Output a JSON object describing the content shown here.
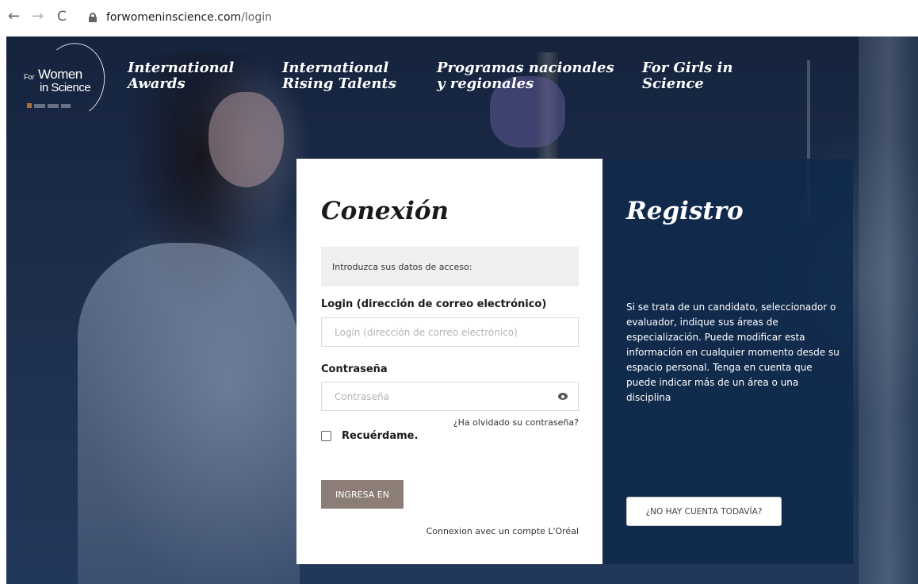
{
  "browser": {
    "url_domain": "forwomeninscience.com",
    "url_path": "/login",
    "back_icon": "←",
    "forward_icon": "→",
    "reload_icon": "C"
  },
  "logo": {
    "for": "For",
    "women": "Women",
    "in_science": "in Science"
  },
  "nav": [
    {
      "line1": "International",
      "line2": "Awards"
    },
    {
      "line1": "International",
      "line2": "Rising Talents"
    },
    {
      "line1": "Programas nacionales",
      "line2": "y regionales"
    },
    {
      "line1": "For Girls in",
      "line2": "Science"
    }
  ],
  "login": {
    "title": "Conexión",
    "info": "Introduzca sus datos de acceso:",
    "email_label": "Login (dirección de correo electrónico)",
    "email_placeholder": "Login (dirección de correo electrónico)",
    "password_label": "Contraseña",
    "password_placeholder": "Contraseña",
    "forgot": "¿Ha olvidado su contraseña?",
    "remember": "Recuérdame.",
    "submit": "INGRESA EN",
    "loreal": "Connexion avec un compte L'Oréal"
  },
  "register": {
    "title": "Registro",
    "text": "Si se trata de un candidato, seleccionador o evaluador, indique sus áreas de especialización. Puede modificar esta información en cualquier momento desde su espacio personal. Tenga en cuenta que puede indicar más de un área o una disciplina",
    "button": "¿NO HAY CUENTA TODAVÍA?"
  },
  "colors": {
    "page_background": "#1d2e4c",
    "register_panel": "#102a4c",
    "submit_button": "#8c7d77",
    "info_box": "#efefef"
  }
}
